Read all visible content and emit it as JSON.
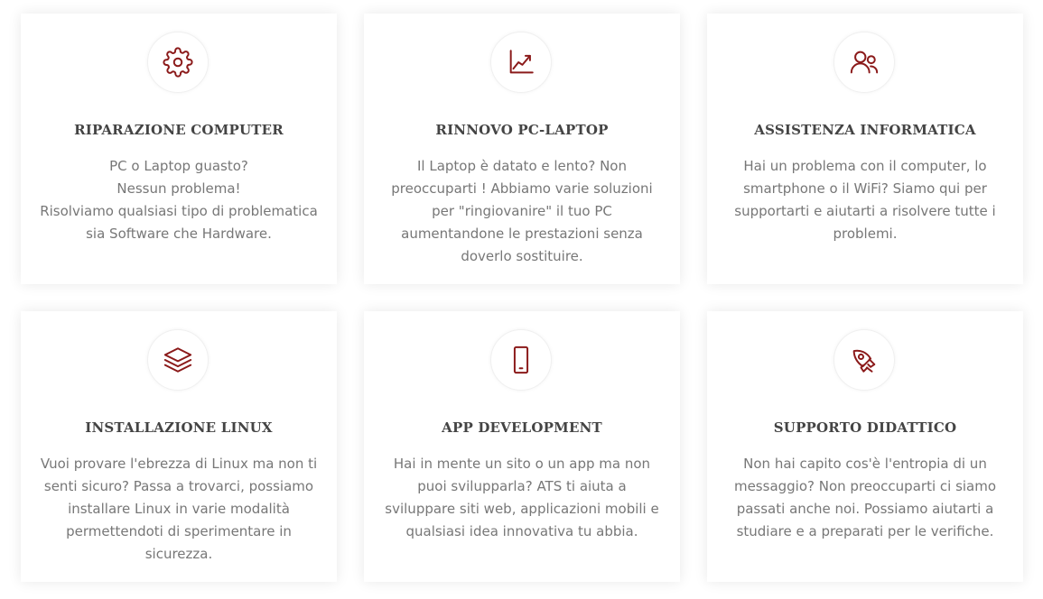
{
  "accent_color": "#8b1a1a",
  "cards": [
    {
      "icon": "gear-icon",
      "title": "RIPARAZIONE COMPUTER",
      "lines": [
        "PC o Laptop guasto?",
        "Nessun problema!",
        "Risolviamo qualsiasi tipo di problematica sia Software che Hardware."
      ]
    },
    {
      "icon": "chart-growth-icon",
      "title": "RINNOVO PC-LAPTOP",
      "lines": [
        "Il Laptop è datato e lento? Non preoccuparti ! Abbiamo varie soluzioni per \"ringiovanire\" il tuo PC aumentandone le prestazioni senza doverlo sostituire."
      ]
    },
    {
      "icon": "users-icon",
      "title": "ASSISTENZA INFORMATICA",
      "lines": [
        "Hai un problema con il computer, lo smartphone o il WiFi? Siamo qui per supportarti e aiutarti a risolvere tutte i problemi."
      ]
    },
    {
      "icon": "layers-icon",
      "title": "INSTALLAZIONE LINUX",
      "lines": [
        "Vuoi provare l'ebrezza di Linux ma non ti senti sicuro? Passa a trovarci, possiamo installare Linux in varie modalità permettendoti di sperimentare in sicurezza."
      ]
    },
    {
      "icon": "smartphone-icon",
      "title": "APP DEVELOPMENT",
      "lines": [
        "Hai in mente un sito o un app ma non puoi svilupparla? ATS ti aiuta a sviluppare siti web, applicazioni mobili e qualsiasi idea innovativa tu abbia."
      ]
    },
    {
      "icon": "rocket-icon",
      "title": "SUPPORTO DIDATTICO",
      "lines": [
        "Non hai capito cos'è l'entropia di un messaggio? Non preoccuparti ci siamo passati anche noi. Possiamo aiutarti a studiare e a preparati per le verifiche."
      ]
    }
  ]
}
